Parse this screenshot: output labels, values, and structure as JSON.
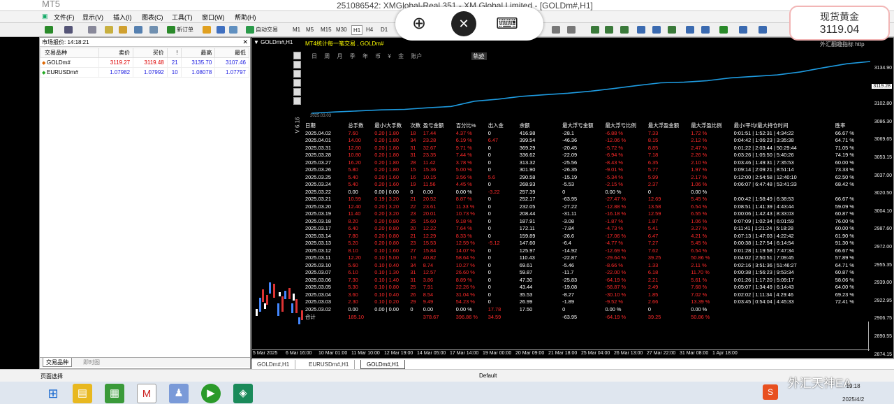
{
  "title_bar": {
    "left_fragment": "MT5 ",
    "title": "251086542: XMGlobal-Real 351 - XM Global Limited - [GOLDm#,H1]"
  },
  "menu": [
    "文件(F)",
    "显示(V)",
    "插入(I)",
    "图表(C)",
    "工具(T)",
    "窗口(W)",
    "帮助(H)"
  ],
  "toolbar": {
    "new_order": "新订单",
    "auto_trading": "自动交易",
    "timeframes": [
      "M1",
      "M5",
      "M15",
      "M30",
      "H1",
      "H4",
      "D1"
    ],
    "active_timeframe": "H1",
    "right_tf": "D"
  },
  "overlay": {
    "icons": [
      "zoom-in-icon",
      "remote-desktop-icon",
      "keyboard-icon"
    ]
  },
  "spot_gold": {
    "label": "现货黄金",
    "price": "3119.04"
  },
  "market_watch": {
    "header": "市场报价: 14:18:21",
    "columns": [
      "交易品种",
      "卖价",
      "买价",
      "!",
      "最高",
      "最低"
    ],
    "rows": [
      {
        "symbol": "GOLDm#",
        "bid": "3119.27",
        "ask": "3119.48",
        "spread": "21",
        "high": "3135.70",
        "low": "3107.46",
        "dir": "up"
      },
      {
        "symbol": "EURUSDm#",
        "bid": "1.07982",
        "ask": "1.07992",
        "spread": "10",
        "high": "1.08078",
        "low": "1.07797",
        "dir": "up"
      }
    ],
    "tabs": [
      "交易品种",
      "即时图"
    ]
  },
  "chart": {
    "title": "GOLDm#,H1",
    "price_labels": [
      "3134.90",
      "3119.28",
      "3102.80",
      "3086.30",
      "3069.65",
      "3053.15",
      "3037.00",
      "3020.50",
      "3004.10",
      "2987.60",
      "2972.00",
      "2955.35",
      "2939.00",
      "2922.95",
      "2906.75",
      "2890.55",
      "2874.15"
    ],
    "current_price": "3119.28",
    "time_labels": [
      "5 Mar 2025",
      "6 Mar 16:00",
      "10 Mar 01:00",
      "11 Mar 10:00",
      "12 Mar 19:00",
      "14 Mar 05:00",
      "17 Mar 14:00",
      "19 Mar 00:00",
      "20 Mar 09:00",
      "21 Mar 18:00",
      "25 Mar 04:00",
      "26 Mar 13:00",
      "27 Mar 22:00",
      "31 Mar 08:00",
      "1 Apr 18:00"
    ],
    "tabs": [
      "GOLDm#,H1",
      "EURUSDm#,H1",
      "GOLDm#,H1"
    ],
    "active_tab": 2
  },
  "ea_panel": {
    "header": "MT4统计每一笔交易 , GOLDm#",
    "right_hint": "外汇翻趣指标  http",
    "tabs": [
      "日",
      "周",
      "月",
      "季",
      "年",
      "币",
      "¥",
      "金",
      "账户",
      "轨迹"
    ],
    "active_tab": "轨迹",
    "side_label": "V 6.16",
    "start_date": "2025.03.03",
    "columns": [
      "日期",
      "总手数",
      "最小/大手数",
      "次数",
      "盈亏金额",
      "百分比%",
      "出入金",
      "余额",
      "最大浮亏金额",
      "最大浮亏比例",
      "最大浮盈金额",
      "最大浮盈比例",
      "最小/平均/最大持仓时间",
      "胜率"
    ],
    "rows": [
      [
        "2025.04.02",
        "7.60",
        "0.20 | 1.80",
        "18",
        "17.44",
        "4.37 %",
        "0",
        "416.98",
        "-28.1",
        "-6.88 %",
        "7.33",
        "1.72 %",
        "0:01:51 | 1:52:31 | 4:34:22",
        "66.67 %"
      ],
      [
        "2025.04.01",
        "14.00",
        "0.20 | 1.80",
        "34",
        "23.28",
        "6.19 %",
        "6.47",
        "399.54",
        "-46.36",
        "-12.06 %",
        "8.15",
        "2.12 %",
        "0:04:42 | 1:06:23 | 3:35:38",
        "64.71 %"
      ],
      [
        "2025.03.31",
        "12.60",
        "0.20 | 1.80",
        "31",
        "32.67",
        "9.71 %",
        "0",
        "369.29",
        "-20.45",
        "-5.72 %",
        "8.85",
        "2.47 %",
        "0:01:22 | 2:03:44 | 50:29:44",
        "71.05 %"
      ],
      [
        "2025.03.28",
        "10.80",
        "0.20 | 1.80",
        "31",
        "23.35",
        "7.44 %",
        "0",
        "336.62",
        "-22.09",
        "-6.94 %",
        "7.18",
        "2.26 %",
        "0:03:26 | 1:05:50 | 5:40:26",
        "74.19 %"
      ],
      [
        "2025.03.27",
        "16.20",
        "0.20 | 1.80",
        "28",
        "11.42",
        "3.78 %",
        "0",
        "313.32",
        "-25.56",
        "-8.43 %",
        "6.35",
        "2.10 %",
        "0:03:46 | 1:49:31 | 7:35:53",
        "60.00 %"
      ],
      [
        "2025.03.26",
        "5.80",
        "0.20 | 1.80",
        "15",
        "15.36",
        "5.00 %",
        "0",
        "301.90",
        "-26.35",
        "-9.01 %",
        "5.77",
        "1.97 %",
        "0:09:14 | 2:09:21 | 8:51:14",
        "73.33 %"
      ],
      [
        "2025.03.25",
        "5.40",
        "0.20 | 1.60",
        "16",
        "10.15",
        "3.56 %",
        "5.6",
        "290.58",
        "-15.19",
        "-5.34 %",
        "5.99",
        "2.17 %",
        "0:12:00 | 2:54:58 | 12:40:10",
        "62.50 %"
      ],
      [
        "2025.03.24",
        "5.40",
        "0.20 | 1.60",
        "19",
        "11.56",
        "4.45 %",
        "0",
        "268.93",
        "-5.53",
        "-2.15 %",
        "2.37",
        "1.06 %",
        "0:06:07 | 6:47:48 | 53:41:33",
        "68.42 %"
      ],
      [
        "2025.03.22",
        "0.00",
        "0.00 | 0.00",
        "0",
        "0.00",
        "0.00 %",
        "-3.22",
        "257.39",
        "0",
        "0.00 %",
        "0",
        "0.00 %",
        "",
        ""
      ],
      [
        "2025.03.21",
        "10.59",
        "0.19 | 3.20",
        "21",
        "20.52",
        "8.87 %",
        "0",
        "252.17",
        "-63.95",
        "-27.47 %",
        "12.69",
        "5.45 %",
        "0:00:42 | 1:58:49 | 6:38:53",
        "66.67 %"
      ],
      [
        "2025.03.20",
        "12.40",
        "0.20 | 3.20",
        "22",
        "23.61",
        "11.33 %",
        "0",
        "232.05",
        "-27.22",
        "-12.88 %",
        "13.58",
        "6.54 %",
        "0:08:51 | 1:41:39 | 4:43:44",
        "59.09 %"
      ],
      [
        "2025.03.19",
        "11.40",
        "0.20 | 3.20",
        "23",
        "20.01",
        "10.73 %",
        "0",
        "208.44",
        "-31.11",
        "-16.18 %",
        "12.59",
        "6.55 %",
        "0:00:06 | 1:42:43 | 8:33:03",
        "60.87 %"
      ],
      [
        "2025.03.18",
        "8.20",
        "0.20 | 0.80",
        "25",
        "15.60",
        "9.18 %",
        "0",
        "187.91",
        "-3.08",
        "-1.87 %",
        "1.87",
        "1.06 %",
        "0:07:09 | 1:02:34 | 6:01:59",
        "76.00 %"
      ],
      [
        "2025.03.17",
        "6.40",
        "0.20 | 0.80",
        "20",
        "12.22",
        "7.64 %",
        "0",
        "172.11",
        "-7.84",
        "-4.73 %",
        "5.41",
        "3.27 %",
        "0:11:41 | 1:21:24 | 5:18:28",
        "60.00 %"
      ],
      [
        "2025.03.14",
        "7.80",
        "0.20 | 0.80",
        "21",
        "12.29",
        "8.33 %",
        "0",
        "159.89",
        "-26.6",
        "-17.06 %",
        "6.47",
        "4.21 %",
        "0:07:13 | 1:47:03 | 4:22:42",
        "61.90 %"
      ],
      [
        "2025.03.13",
        "5.20",
        "0.20 | 0.80",
        "23",
        "15.53",
        "12.59 %",
        "-5.12",
        "147.60",
        "-6.4",
        "-4.77 %",
        "7.27",
        "5.45 %",
        "0:00:38 | 1:27:54 | 6:14:54",
        "91.30 %"
      ],
      [
        "2025.03.12",
        "8.10",
        "0.10 | 1.60",
        "27",
        "15.84",
        "14.07 %",
        "0",
        "125.97",
        "-14.92",
        "-12.69 %",
        "7.62",
        "6.54 %",
        "0:01:28 | 1:19:58 | 7:47:34",
        "66.67 %"
      ],
      [
        "2025.03.11",
        "12.20",
        "0.10 | 5.00",
        "19",
        "40.82",
        "58.64 %",
        "0",
        "110.43",
        "-22.87",
        "-29.64 %",
        "39.25",
        "50.86 %",
        "0:04:02 | 2:50:51 | 7:09:45",
        "57.89 %"
      ],
      [
        "2025.03.10",
        "5.60",
        "0.10 | 0.40",
        "34",
        "8.74",
        "10.27 %",
        "0",
        "69.61",
        "-5.46",
        "-8.66 %",
        "1.33",
        "2.11 %",
        "0:02:16 | 3:51:36 | 51:46:27",
        "64.71 %"
      ],
      [
        "2025.03.07",
        "6.10",
        "0.10 | 1.30",
        "31",
        "12.57",
        "26.60 %",
        "0",
        "59.87",
        "-11.7",
        "-22.00 %",
        "6.18",
        "11.70 %",
        "0:00:38 | 1:56:23 | 9:53:34",
        "60.87 %"
      ],
      [
        "2025.03.06",
        "7.30",
        "0.10 | 1.40",
        "31",
        "3.86",
        "8.89 %",
        "0",
        "47.30",
        "-25.83",
        "-64.19 %",
        "2.21",
        "5.61 %",
        "0:01:26 | 1:17:20 | 5:09:17",
        "58.06 %"
      ],
      [
        "2025.03.05",
        "5.30",
        "0.10 | 0.80",
        "25",
        "7.91",
        "22.26 %",
        "0",
        "43.44",
        "-19.08",
        "-58.87 %",
        "2.49",
        "7.68 %",
        "0:05:07 | 1:34:49 | 6:14:43",
        "64.00 %"
      ],
      [
        "2025.03.04",
        "3.60",
        "0.10 | 0.40",
        "26",
        "8.54",
        "31.04 %",
        "0",
        "35.53",
        "-8.27",
        "-30.10 %",
        "1.85",
        "7.02 %",
        "0:02:02 | 1:11:34 | 4:29:46",
        "69.23 %"
      ],
      [
        "2025.03.03",
        "2.30",
        "0.10 | 0.20",
        "29",
        "9.49",
        "54.23 %",
        "0",
        "26.99",
        "-1.89",
        "-9.52 %",
        "2.66",
        "13.39 %",
        "0:03:45 | 0:54:04 | 4:45:33",
        "72.41 %"
      ],
      [
        "2025.03.02",
        "0.00",
        "0.00 | 0.00",
        "0",
        "0.00",
        "0.00 %",
        "17.78",
        "17.50",
        "0",
        "0.00 %",
        "0",
        "0.00 %",
        "",
        ""
      ],
      [
        "合计",
        "185.10",
        "",
        "",
        "378.67",
        "396.86 %",
        "34.59",
        "",
        "-63.95",
        "-64.19 %",
        "39.25",
        "50.86 %",
        "",
        ""
      ]
    ]
  },
  "status_bar": {
    "left": "页面选择",
    "center": "Default"
  },
  "watermark": "外汇天神EA",
  "clock": {
    "time": "19:18",
    "date": "2025/4/2"
  }
}
